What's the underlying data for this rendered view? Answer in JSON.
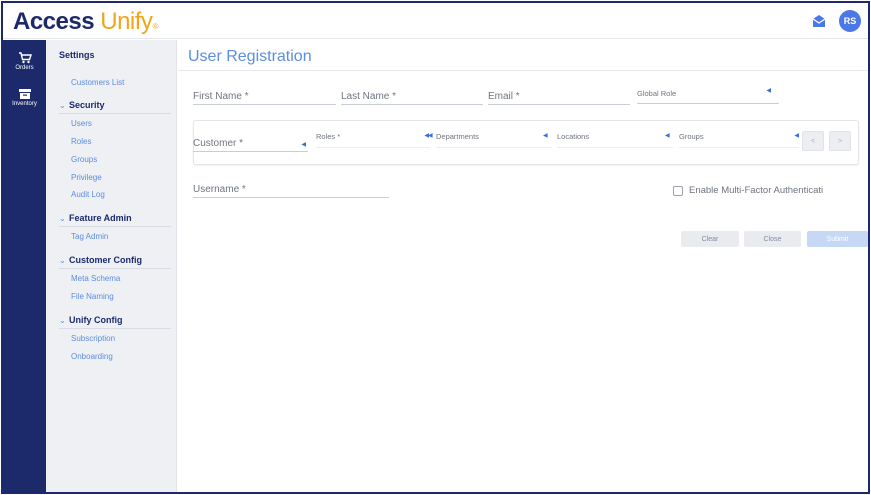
{
  "brand": {
    "name_bold": "Access",
    "name_light": "Unify",
    "reg_mark": "®"
  },
  "header": {
    "avatar_initials": "RS",
    "mail_icon": "mail-open-icon"
  },
  "rail": {
    "items": [
      {
        "label": "Orders",
        "icon": "cart-icon"
      },
      {
        "label": "Inventory",
        "icon": "box-icon"
      }
    ]
  },
  "sidebar": {
    "title": "Settings",
    "top_link": "Customers List",
    "groups": [
      {
        "label": "Security",
        "items": [
          "Users",
          "Roles",
          "Groups",
          "Privilege",
          "Audit Log"
        ]
      },
      {
        "label": "Feature Admin",
        "items": [
          "Tag Admin"
        ]
      },
      {
        "label": "Customer Config",
        "items": [
          "Meta Schema",
          "File Naming"
        ]
      },
      {
        "label": "Unify Config",
        "items": [
          "Subscription",
          "Onboarding"
        ]
      }
    ]
  },
  "form": {
    "title": "User Registration",
    "first_name": "First Name *",
    "last_name": "Last Name *",
    "email": "Email *",
    "global_role": "Global Role",
    "customer": "Customer *",
    "roles": "Roles *",
    "departments": "Departments",
    "locations": "Locations",
    "groups": "Groups",
    "username": "Username *",
    "mfa_label": "Enable Multi-Factor Authenticati",
    "prev_label": "<",
    "next_label": ">",
    "clear_label": "Clear",
    "close_label": "Close",
    "submit_label": "Submit"
  },
  "colors": {
    "brand_navy": "#1c2a6b",
    "brand_orange": "#f2a51a",
    "accent_blue": "#5b8de0",
    "avatar_blue": "#4a78e8"
  }
}
